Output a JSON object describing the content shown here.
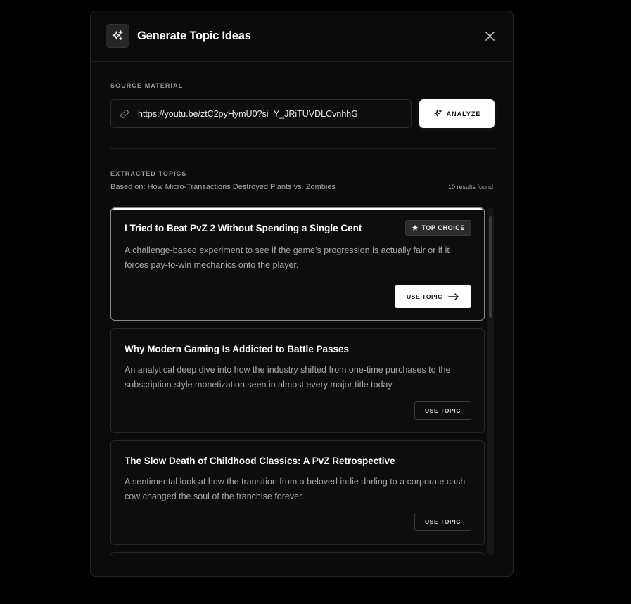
{
  "modal": {
    "title": "Generate Topic Ideas",
    "close_icon": "close-icon",
    "header_icon": "sparkles-icon"
  },
  "source": {
    "label": "SOURCE MATERIAL",
    "url_value": "https://youtu.be/ztC2pyHymU0?si=Y_JRiTUVDLCvnhhG",
    "link_icon": "link-icon",
    "analyze_label": "ANALYZE",
    "analyze_icon": "sparkles-icon"
  },
  "topics": {
    "label": "EXTRACTED TOPICS",
    "based_on": "Based on: How Micro-Transactions Destroyed Plants vs. Zombies",
    "results_count": "10 results found",
    "items": [
      {
        "title": "I Tried to Beat PvZ 2 Without Spending a Single Cent",
        "description": "A challenge-based experiment to see if the game’s progression is actually fair or if it forces pay-to-win mechanics onto the player.",
        "badge": "TOP CHOICE",
        "button": "USE TOPIC"
      },
      {
        "title": "Why Modern Gaming Is Addicted to Battle Passes",
        "description": "An analytical deep dive into how the industry shifted from one-time purchases to the subscription-style monetization seen in almost every major title today.",
        "button": "USE TOPIC"
      },
      {
        "title": "The Slow Death of Childhood Classics: A PvZ Retrospective",
        "description": "A sentimental look at how the transition from a beloved indie darling to a corporate cash-cow changed the soul of the franchise forever.",
        "button": "USE TOPIC"
      }
    ]
  },
  "colors": {
    "background": "#000000",
    "modal": "#0b0b0b",
    "accent": "#ffffff",
    "muted_text": "#a8a8a8"
  }
}
